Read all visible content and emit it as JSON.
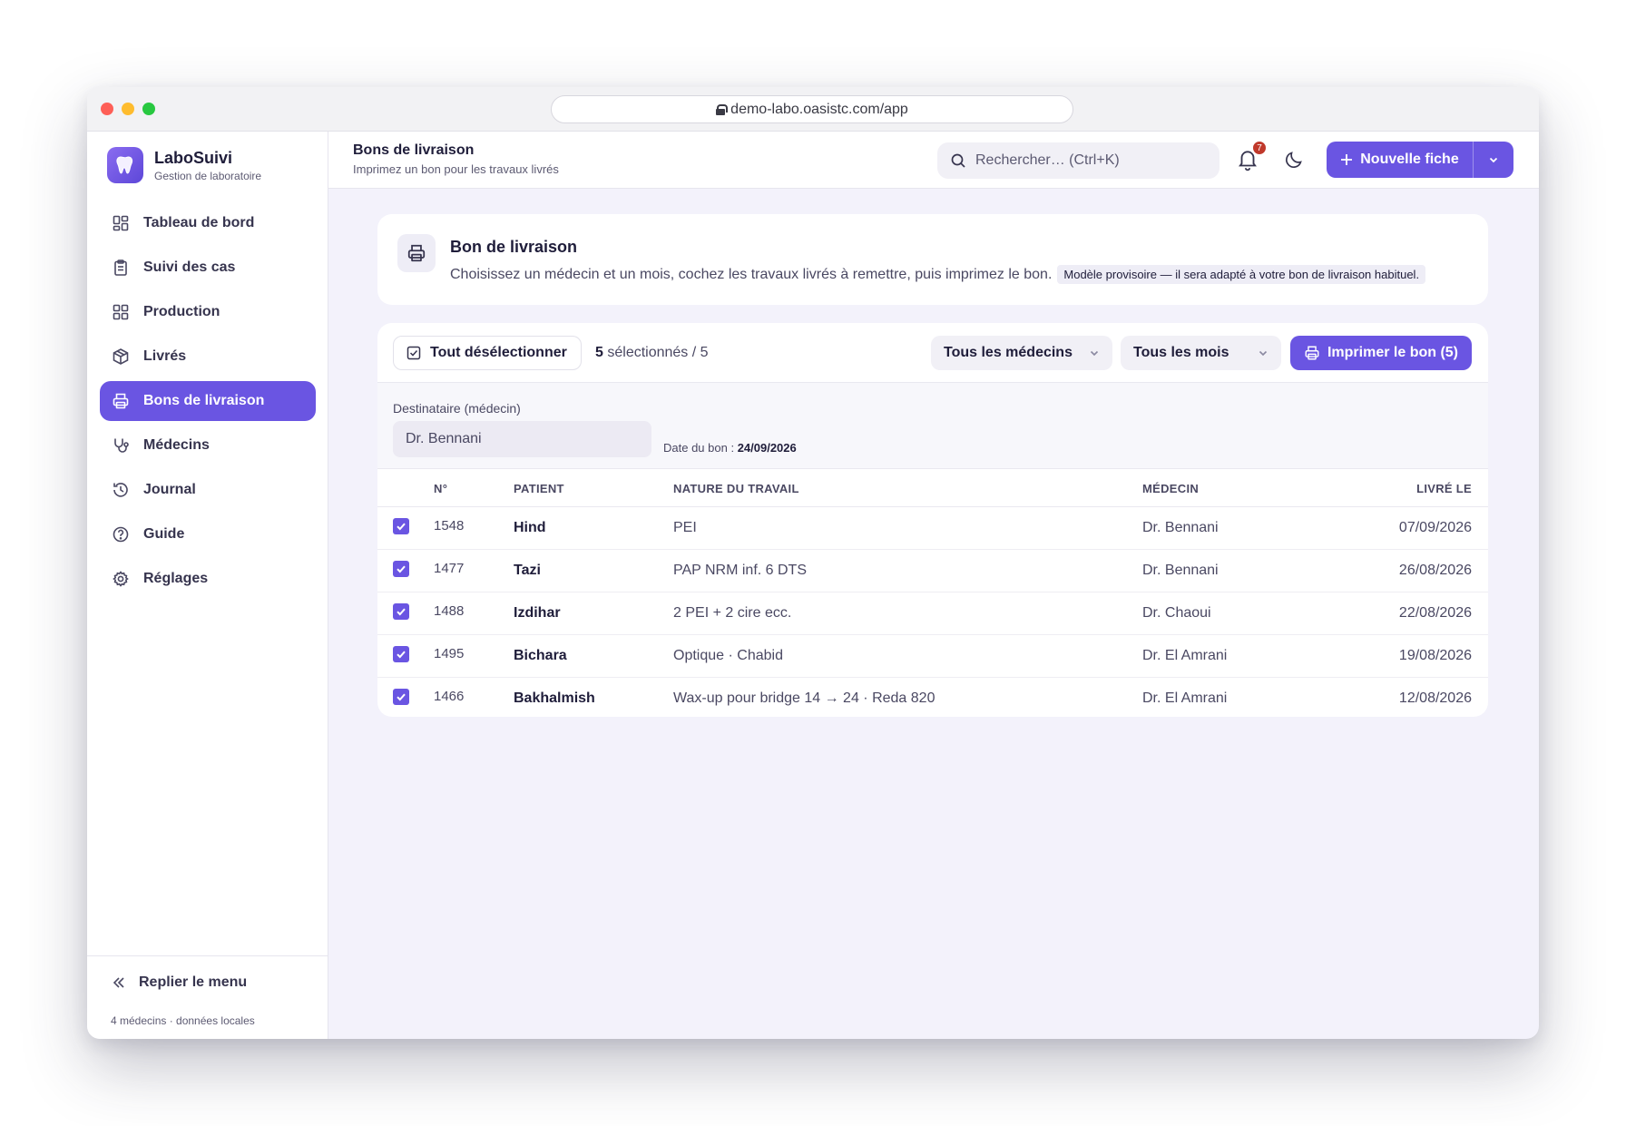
{
  "browser": {
    "url": "demo-labo.oasistc.com/app"
  },
  "brand": {
    "name": "LaboSuivi",
    "subtitle": "Gestion de laboratoire"
  },
  "sidebar": {
    "items": [
      {
        "label": "Tableau de bord",
        "icon": "dashboard-icon"
      },
      {
        "label": "Suivi des cas",
        "icon": "clipboard-icon"
      },
      {
        "label": "Production",
        "icon": "grid-icon"
      },
      {
        "label": "Livrés",
        "icon": "package-icon"
      },
      {
        "label": "Bons de livraison",
        "icon": "printer-icon",
        "active": true
      },
      {
        "label": "Médecins",
        "icon": "stethoscope-icon"
      },
      {
        "label": "Journal",
        "icon": "history-icon"
      },
      {
        "label": "Guide",
        "icon": "help-icon"
      },
      {
        "label": "Réglages",
        "icon": "gear-icon"
      }
    ],
    "collapse_label": "Replier le menu",
    "footer": "4 médecins · données locales"
  },
  "header": {
    "title": "Bons de livraison",
    "subtitle": "Imprimez un bon pour les travaux livrés",
    "search_placeholder": "Rechercher…  (Ctrl+K)",
    "notifications_count": "7",
    "new_button": "Nouvelle fiche"
  },
  "intro": {
    "title": "Bon de livraison",
    "description": "Choisissez un médecin et un mois, cochez les travaux livrés à remettre, puis imprimez le bon.",
    "note": "Modèle provisoire — il sera adapté à votre bon de livraison habituel."
  },
  "toolbar": {
    "deselect_label": "Tout désélectionner",
    "selected_count": "5",
    "selected_text": "sélectionnés / 5",
    "doctor_filter": "Tous les médecins",
    "month_filter": "Tous les mois",
    "print_label": "Imprimer le bon (5)"
  },
  "recipient": {
    "label": "Destinataire (médecin)",
    "value": "Dr. Bennani",
    "date_label": "Date du bon :",
    "date_value": "24/09/2026"
  },
  "table": {
    "headers": {
      "num": "N°",
      "patient": "PATIENT",
      "nature": "NATURE DU TRAVAIL",
      "medecin": "MÉDECIN",
      "livre": "LIVRÉ LE"
    },
    "rows": [
      {
        "checked": true,
        "num": "1548",
        "patient": "Hind",
        "nature": "PEI",
        "medecin": "Dr. Bennani",
        "livre": "07/09/2026"
      },
      {
        "checked": true,
        "num": "1477",
        "patient": "Tazi",
        "nature": "PAP NRM inf. 6 DTS",
        "medecin": "Dr. Bennani",
        "livre": "26/08/2026"
      },
      {
        "checked": true,
        "num": "1488",
        "patient": "Izdihar",
        "nature": "2 PEI + 2 cire ecc.",
        "medecin": "Dr. Chaoui",
        "livre": "22/08/2026"
      },
      {
        "checked": true,
        "num": "1495",
        "patient": "Bichara",
        "nature": "Optique · Chabid",
        "medecin": "Dr. El Amrani",
        "livre": "19/08/2026"
      },
      {
        "checked": true,
        "num": "1466",
        "patient": "Bakhalmish",
        "nature": "Wax-up pour bridge 14 → 24 · Reda 820",
        "medecin": "Dr. El Amrani",
        "livre": "12/08/2026"
      }
    ]
  },
  "colors": {
    "accent": "#6a55e2",
    "badge": "#c0392b",
    "background": "#f3f2fb"
  }
}
